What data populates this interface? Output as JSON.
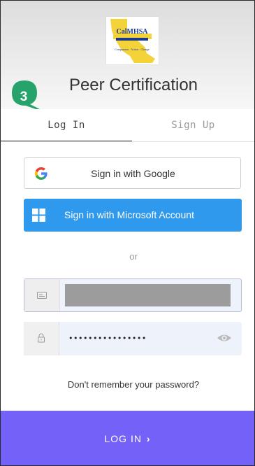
{
  "header": {
    "logo_text": "CalMHSA",
    "logo_tagline": "Compassion · Action · Change",
    "title": "Peer Certification"
  },
  "step_badge": {
    "number": "3",
    "color": "#26a36b"
  },
  "tabs": [
    {
      "label": "Log In",
      "active": true
    },
    {
      "label": "Sign Up",
      "active": false
    }
  ],
  "social": {
    "google_label": "Sign in with Google",
    "microsoft_label": "Sign in with Microsoft Account",
    "microsoft_color": "#2f99ee"
  },
  "divider_text": "or",
  "form": {
    "password_value": "••••••••••••••••",
    "username_icon": "id-card-icon",
    "password_icon": "lock-icon",
    "reveal_icon": "eye-icon"
  },
  "forgot_link": "Don't remember your password?",
  "login_button": {
    "label": "LOG IN",
    "chevron": "›",
    "color": "#7461f8"
  }
}
